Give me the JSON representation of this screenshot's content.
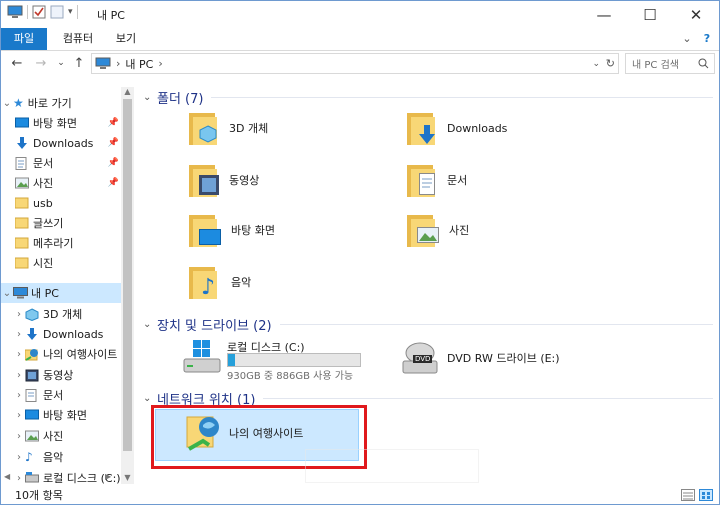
{
  "window": {
    "title": "내 PC",
    "controls": {
      "minimize": "—",
      "maximize": "☐",
      "close": "✕"
    }
  },
  "ribbon": {
    "tabs": [
      "파일",
      "컴퓨터",
      "보기"
    ],
    "expand_glyph": "⌄",
    "help_glyph": "?"
  },
  "address": {
    "path": [
      "내 PC"
    ],
    "separator": "›",
    "refresh_glyph": "↻",
    "search_placeholder": "내 PC 검색"
  },
  "navigation": {
    "quick_access": {
      "label": "바로 가기",
      "items": [
        {
          "label": "바탕 화면",
          "icon": "desktop-icon",
          "pinned": true
        },
        {
          "label": "Downloads",
          "icon": "download-icon",
          "pinned": true
        },
        {
          "label": "문서",
          "icon": "document-icon",
          "pinned": true
        },
        {
          "label": "사진",
          "icon": "pictures-icon",
          "pinned": true
        },
        {
          "label": "usb",
          "icon": "folder-icon",
          "pinned": false
        },
        {
          "label": "글쓰기",
          "icon": "folder-icon",
          "pinned": false
        },
        {
          "label": "메추라기",
          "icon": "folder-icon",
          "pinned": false
        },
        {
          "label": "시진",
          "icon": "folder-icon",
          "pinned": false
        }
      ]
    },
    "this_pc": {
      "label": "내 PC",
      "items": [
        {
          "label": "3D 개체",
          "icon": "3d-objects-icon"
        },
        {
          "label": "Downloads",
          "icon": "download-icon"
        },
        {
          "label": "나의 여행사이트",
          "icon": "network-location-icon"
        },
        {
          "label": "동영상",
          "icon": "video-icon"
        },
        {
          "label": "문서",
          "icon": "document-icon"
        },
        {
          "label": "바탕 화면",
          "icon": "desktop-icon"
        },
        {
          "label": "사진",
          "icon": "pictures-icon"
        },
        {
          "label": "음악",
          "icon": "music-icon"
        },
        {
          "label": "로컬 디스크 (C:)",
          "icon": "drive-icon"
        }
      ]
    }
  },
  "groups": {
    "folders": {
      "title": "폴더 (7)",
      "items": [
        {
          "label": "3D 개체",
          "icon": "3d-objects-icon"
        },
        {
          "label": "Downloads",
          "icon": "download-icon"
        },
        {
          "label": "동영상",
          "icon": "video-icon"
        },
        {
          "label": "문서",
          "icon": "document-icon"
        },
        {
          "label": "바탕 화면",
          "icon": "desktop-icon"
        },
        {
          "label": "사진",
          "icon": "pictures-icon"
        },
        {
          "label": "음악",
          "icon": "music-icon"
        }
      ]
    },
    "devices": {
      "title": "장치 및 드라이브 (2)",
      "local_disk": {
        "label": "로컬 디스크 (C:)",
        "free": "930GB 중 886GB 사용 가능",
        "used_fraction": 0.05
      },
      "dvd": {
        "label": "DVD RW 드라이브 (E:)",
        "badge": "DVD"
      }
    },
    "network": {
      "title": "네트워크 위치 (1)",
      "items": [
        {
          "label": "나의 여행사이트",
          "icon": "network-location-icon"
        }
      ]
    }
  },
  "status": {
    "count": "10개 항목"
  },
  "colors": {
    "accent": "#1979ca",
    "selection": "#cce8ff",
    "highlight_box": "#e0191d",
    "group_title": "#1e3287",
    "folder": "#f8d776"
  }
}
